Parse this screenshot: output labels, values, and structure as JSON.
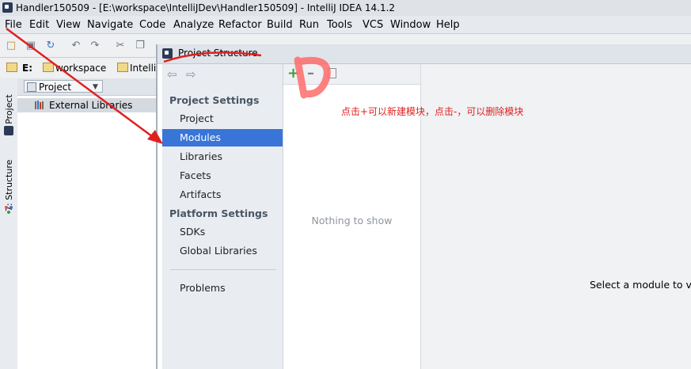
{
  "window": {
    "title": "Handler150509 - [E:\\workspace\\IntelliJDev\\Handler150509] - IntelliJ IDEA 14.1.2"
  },
  "menu": {
    "items": [
      "File",
      "Edit",
      "View",
      "Navigate",
      "Code",
      "Analyze",
      "Refactor",
      "Build",
      "Run",
      "Tools",
      "VCS",
      "Window",
      "Help"
    ]
  },
  "navbar": {
    "drive": "E:",
    "folder1": "workspace",
    "folder2": "Intelli"
  },
  "toolwindows": {
    "project_tab": "1: Project",
    "structure_tab": "7: Structure"
  },
  "project_panel": {
    "view_selector": "Project",
    "tree_item": "External Libraries"
  },
  "dialog": {
    "title": "Project Structure",
    "sections": [
      {
        "header": "Project Settings",
        "items": [
          "Project",
          "Modules",
          "Libraries",
          "Facets",
          "Artifacts"
        ]
      },
      {
        "header": "Platform Settings",
        "items": [
          "SDKs",
          "Global Libraries"
        ]
      }
    ],
    "problems": "Problems",
    "selected": "Modules",
    "middle_empty": "Nothing to show",
    "right_hint": "Select a module to vie"
  },
  "annotation": {
    "text": "点击+可以新建模块，点击-，可以删除模块",
    "color": "#e02020"
  },
  "colors": {
    "selection": "#3875d7",
    "add_icon": "#3a9d3a"
  }
}
